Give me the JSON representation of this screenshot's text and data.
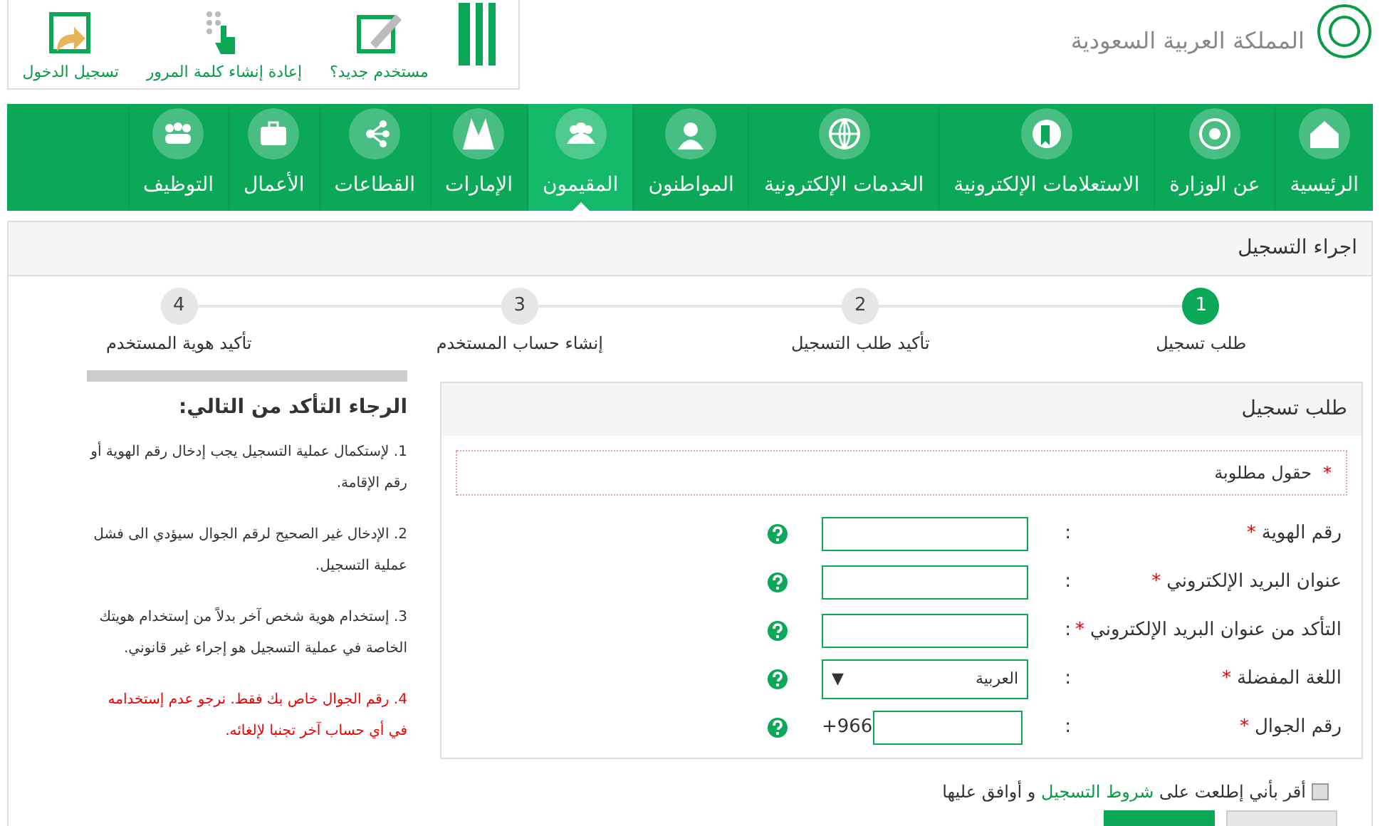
{
  "header": {
    "logo_subtitle": "المملكة العربية السعودية",
    "quick_links": [
      {
        "label": "مستخدم جديد؟"
      },
      {
        "label": "إعادة إنشاء كلمة المرور"
      },
      {
        "label": "تسجيل الدخول"
      }
    ]
  },
  "nav": {
    "items": [
      {
        "label": "الرئيسية",
        "selected": false
      },
      {
        "label": "عن الوزارة",
        "selected": false
      },
      {
        "label": "الاستعلامات الإلكترونية",
        "selected": false
      },
      {
        "label": "الخدمات الإلكترونية",
        "selected": false
      },
      {
        "label": "المواطنون",
        "selected": false
      },
      {
        "label": "المقيمون",
        "selected": true
      },
      {
        "label": "الإمارات",
        "selected": false
      },
      {
        "label": "القطاعات",
        "selected": false
      },
      {
        "label": "الأعمال",
        "selected": false
      },
      {
        "label": "التوظيف",
        "selected": false
      }
    ]
  },
  "registration": {
    "title": "اجراء التسجيل",
    "steps": [
      {
        "number": "1",
        "label": "طلب تسجيل",
        "selected": true
      },
      {
        "number": "2",
        "label": "تأكيد طلب التسجيل",
        "selected": false
      },
      {
        "number": "3",
        "label": "إنشاء حساب المستخدم",
        "selected": false
      },
      {
        "number": "4",
        "label": "تأكيد هوية المستخدم",
        "selected": false
      }
    ],
    "form": {
      "title": "طلب تسجيل",
      "required_mark": "*",
      "required_note": "حقول مطلوبة",
      "fields": [
        {
          "kind": "text",
          "label": "رقم الهوية",
          "mark": "*",
          "colon": ":"
        },
        {
          "kind": "text",
          "label": "عنوان البريد الإلكتروني",
          "mark": "*",
          "colon": ":"
        },
        {
          "kind": "text",
          "label": "التأكد من عنوان البريد الإلكتروني",
          "mark": "*",
          "colon": ":"
        },
        {
          "kind": "select",
          "label": "اللغة المفضلة",
          "mark": "*",
          "colon": ":",
          "value": "العربية",
          "arrow": "▼"
        },
        {
          "kind": "phone",
          "label": "رقم الجوال",
          "mark": "*",
          "colon": ":",
          "prefix": "+966"
        }
      ],
      "agreement": {
        "checked": false,
        "before": "أقر بأني إطلعت على",
        "link": "شروط التسجيل",
        "after": "و أوافق عليها"
      }
    },
    "notes": {
      "title": "الرجاء التأكد من التالي:",
      "items": [
        {
          "kind": "normal",
          "text": "1. لإستكمال عملية التسجيل يجب إدخال رقم الهوية أو رقم الإقامة."
        },
        {
          "kind": "normal",
          "text": "2. الإدخال غير الصحيح لرقم الجوال سيؤدي الى فشل عملية التسجيل."
        },
        {
          "kind": "normal",
          "text": "3. إستخدام هوية شخص آخر بدلاً من إستخدام هويتك الخاصة في عملية التسجيل هو إجراء غير قانوني."
        },
        {
          "kind": "warning",
          "text": "4. رقم الجوال خاص بك فقط. نرجو عدم إستخدامه في أي حساب آخر تجنبا لإلغائه."
        }
      ]
    }
  }
}
